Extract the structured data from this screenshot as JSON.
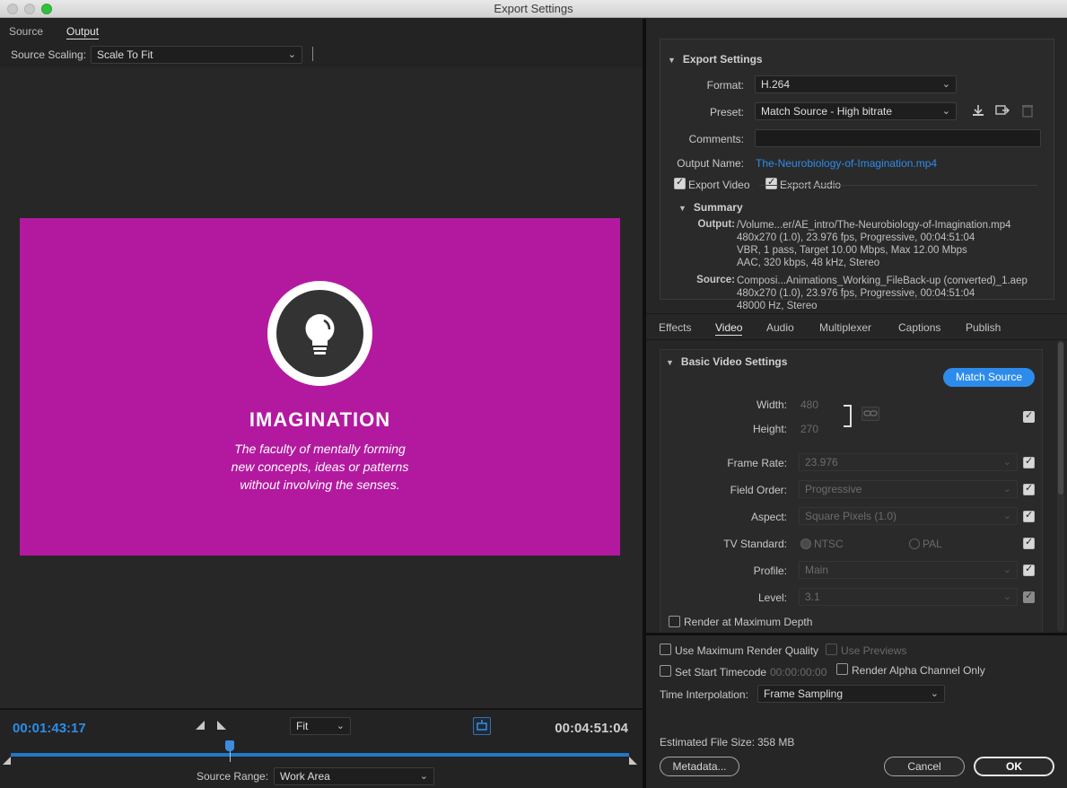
{
  "window": {
    "title": "Export Settings"
  },
  "source_panel": {
    "tabs": [
      "Source",
      "Output"
    ],
    "active_tab": "Output",
    "source_scaling_label": "Source Scaling:",
    "source_scaling_value": "Scale To Fit",
    "preview": {
      "title": "IMAGINATION",
      "subtitle_lines": [
        "The faculty of mentally forming",
        "new concepts, ideas or patterns",
        "without involving the senses."
      ],
      "background_color": "#b3199f"
    },
    "timeline": {
      "current_timecode": "00:01:43:17",
      "end_timecode": "00:04:51:04",
      "zoom_value": "Fit",
      "source_range_label": "Source Range:",
      "source_range_value": "Work Area",
      "playhead_fraction": 0.354
    }
  },
  "export_settings": {
    "heading": "Export Settings",
    "format_label": "Format:",
    "format_value": "H.264",
    "preset_label": "Preset:",
    "preset_value": "Match Source - High bitrate",
    "comments_label": "Comments:",
    "comments_value": "",
    "output_name_label": "Output Name:",
    "output_name_value": "The-Neurobiology-of-Imagination.mp4",
    "export_video_label": "Export Video",
    "export_video_checked": true,
    "export_audio_label": "Export Audio",
    "export_audio_checked": true,
    "summary": {
      "heading": "Summary",
      "output_key": "Output:",
      "output_lines": [
        "/Volume...er/AE_intro/The-Neurobiology-of-Imagination.mp4",
        "480x270 (1.0), 23.976 fps, Progressive, 00:04:51:04",
        "VBR, 1 pass, Target 10.00 Mbps, Max 12.00 Mbps",
        "AAC, 320 kbps, 48 kHz, Stereo"
      ],
      "source_key": "Source:",
      "source_lines": [
        "Composi...Animations_Working_FileBack-up (converted)_1.aep",
        "480x270 (1.0), 23.976 fps, Progressive, 00:04:51:04",
        "48000 Hz, Stereo"
      ]
    }
  },
  "settings_tabs": [
    "Effects",
    "Video",
    "Audio",
    "Multiplexer",
    "Captions",
    "Publish"
  ],
  "active_settings_tab": "Video",
  "basic_video": {
    "heading": "Basic Video Settings",
    "match_source_label": "Match Source",
    "width_label": "Width:",
    "width_value": "480",
    "height_label": "Height:",
    "height_value": "270",
    "frame_rate_label": "Frame Rate:",
    "frame_rate_value": "23.976",
    "field_order_label": "Field Order:",
    "field_order_value": "Progressive",
    "aspect_label": "Aspect:",
    "aspect_value": "Square Pixels (1.0)",
    "tv_standard_label": "TV Standard:",
    "tv_ntsc": "NTSC",
    "tv_pal": "PAL",
    "profile_label": "Profile:",
    "profile_value": "Main",
    "level_label": "Level:",
    "level_value": "3.1",
    "render_max_depth_label": "Render at Maximum Depth"
  },
  "bottom": {
    "use_max_render_quality": "Use Maximum Render Quality",
    "use_previews": "Use Previews",
    "set_start_timecode": "Set Start Timecode",
    "start_timecode_value": "00:00:00:00",
    "render_alpha_only": "Render Alpha Channel Only",
    "time_interpolation_label": "Time Interpolation:",
    "time_interpolation_value": "Frame Sampling",
    "estimated_file_size_label": "Estimated File Size:",
    "estimated_file_size_value": "358 MB",
    "metadata_button": "Metadata...",
    "cancel_button": "Cancel",
    "ok_button": "OK"
  },
  "colors": {
    "accent": "#2d8ceb",
    "background": "#232323"
  }
}
